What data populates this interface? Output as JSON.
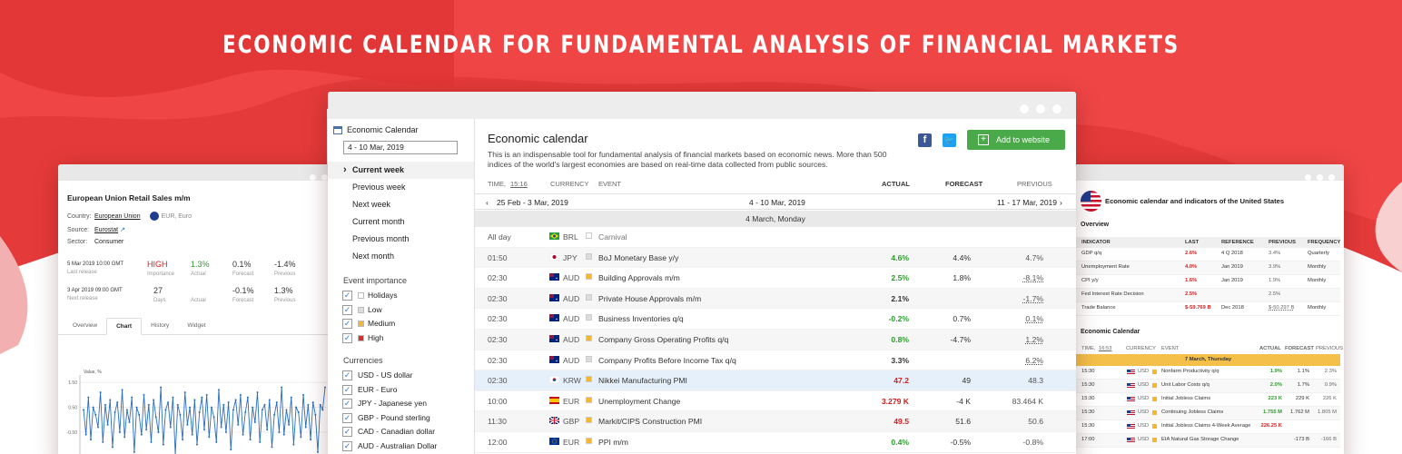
{
  "banner": "ECONOMIC CALENDAR FOR FUNDAMENTAL ANALYSIS OF FINANCIAL MARKETS",
  "colors": {
    "banner_red": "#e53a3a",
    "green": "#2a9a2a",
    "red": "#d21e1e",
    "add_button": "#4aaa4a"
  },
  "left": {
    "title": "European Union Retail Sales m/m",
    "country_label": "Country:",
    "country_value": "European Union",
    "country_extra": "EUR, Euro",
    "source_label": "Source:",
    "source_value": "Eurostat",
    "sector_label": "Sector:",
    "sector_value": "Consumer",
    "last": {
      "date": "5 Mar 2019 10:00 GMT",
      "date_sub": "Last release",
      "importance": "HIGH",
      "importance_sub": "Importance",
      "actual": "1.3%",
      "actual_sub": "Actual",
      "forecast": "0.1%",
      "forecast_sub": "Forecast",
      "previous": "-1.4%",
      "previous_sub": "Previous"
    },
    "next": {
      "date": "3 Apr 2019 09:00 GMT",
      "date_sub": "Next release",
      "days": "27",
      "days_sub": "Days",
      "actual_sub": "Actual",
      "forecast": "-0.1%",
      "forecast_sub": "Forecast",
      "previous": "1.3%",
      "previous_sub": "Previous"
    },
    "tabs": [
      "Overview",
      "Chart",
      "History",
      "Widget"
    ],
    "chart_label": "Value, %",
    "chart_ticks": [
      "1.50",
      "0.50",
      "-0.50",
      "-1.50"
    ]
  },
  "chart_data": {
    "type": "line",
    "title": "",
    "ylabel": "Value, %",
    "ylim": [
      -2.0,
      1.8
    ],
    "values": [
      0.4,
      -0.6,
      0.9,
      -0.8,
      0.5,
      0.2,
      -0.3,
      1.1,
      -0.9,
      0.6,
      -0.2,
      0.8,
      -1.1,
      0.3,
      0.7,
      -0.5,
      1.2,
      -0.7,
      0.4,
      -0.1,
      0.9,
      -1.3,
      0.5,
      0.2,
      -0.6,
      1.0,
      -0.4,
      0.6,
      -0.9,
      0.8,
      0.1,
      -0.5,
      1.3,
      -1.0,
      0.4,
      0.7,
      -0.3,
      0.9,
      -1.4,
      0.6,
      0.2,
      -0.8,
      1.1,
      -0.2,
      0.5,
      -0.6,
      0.8,
      -1.0,
      0.3,
      0.9,
      -0.4,
      1.0,
      -0.7,
      0.5,
      0.1,
      -0.9,
      1.2,
      -0.3,
      0.6,
      -0.5,
      0.7,
      -1.2,
      0.4,
      0.8,
      -0.2,
      1.0,
      -0.6,
      0.3,
      0.9,
      -0.8,
      0.5,
      -0.1,
      1.1,
      -0.9,
      0.4,
      0.6,
      -0.4,
      0.8,
      -1.1,
      0.2,
      0.7,
      -0.5,
      1.3,
      -0.6,
      0.4,
      -0.2,
      0.9,
      -1.0,
      0.5,
      0.3,
      -0.7,
      1.0,
      -0.3,
      0.6,
      -0.8,
      0.7,
      0.2,
      -1.3,
      0.6,
      0.4,
      1.3
    ]
  },
  "main": {
    "sidebar": {
      "title": "Economic Calendar",
      "date_value": "4 - 10 Mar, 2019",
      "nav": [
        "Current week",
        "Previous week",
        "Next week",
        "Current month",
        "Previous month",
        "Next month"
      ],
      "importance_title": "Event importance",
      "importance": [
        {
          "label": "Holidays",
          "color": "#ffffff"
        },
        {
          "label": "Low",
          "color": "#dcdcdc"
        },
        {
          "label": "Medium",
          "color": "#f5b731"
        },
        {
          "label": "High",
          "color": "#d9302c"
        }
      ],
      "currencies_title": "Currencies",
      "currencies": [
        "USD - US dollar",
        "EUR - Euro",
        "JPY - Japanese yen",
        "GBP - Pound sterling",
        "CAD - Canadian dollar",
        "AUD - Australian Dollar"
      ]
    },
    "title": "Economic calendar",
    "description": "This is an indispensable tool for fundamental analysis of financial markets based on economic news. More than 500 indices of the world's largest economies are based on real-time data collected from public sources.",
    "add_button": "Add to website",
    "headers": {
      "time_prefix": "TIME,",
      "time": "15:16",
      "currency": "CURRENCY",
      "event": "EVENT",
      "actual": "ACTUAL",
      "forecast": "FORECAST",
      "previous": "PREVIOUS"
    },
    "week_prev": "25 Feb - 3 Mar, 2019",
    "week_cur": "4 - 10 Mar, 2019",
    "week_next": "11 - 17 Mar, 2019",
    "day": "4 March, Monday",
    "rows": [
      {
        "time": "All day",
        "cur": "BRL",
        "flag": "br",
        "imp": "#ffffff",
        "event": "Carnival",
        "actual": "",
        "forecast": "",
        "previous": "",
        "ac": "",
        "pu": false,
        "muted": true
      },
      {
        "time": "01:50",
        "cur": "JPY",
        "flag": "jp",
        "imp": "#dcdcdc",
        "event": "BoJ Monetary Base y/y",
        "actual": "4.6%",
        "forecast": "4.4%",
        "previous": "4.7%",
        "ac": "green",
        "pu": false
      },
      {
        "time": "02:30",
        "cur": "AUD",
        "flag": "au",
        "imp": "#f5b731",
        "event": "Building Approvals m/m",
        "actual": "2.5%",
        "forecast": "1.8%",
        "previous": "-8.1%",
        "ac": "green",
        "pu": true
      },
      {
        "time": "02:30",
        "cur": "AUD",
        "flag": "au",
        "imp": "#dcdcdc",
        "event": "Private House Approvals m/m",
        "actual": "2.1%",
        "forecast": "",
        "previous": "-1.7%",
        "ac": "bold",
        "pu": true
      },
      {
        "time": "02:30",
        "cur": "AUD",
        "flag": "au",
        "imp": "#dcdcdc",
        "event": "Business Inventories q/q",
        "actual": "-0.2%",
        "forecast": "0.7%",
        "previous": "0.1%",
        "ac": "green",
        "pu": true
      },
      {
        "time": "02:30",
        "cur": "AUD",
        "flag": "au",
        "imp": "#f5b731",
        "event": "Company Gross Operating Profits q/q",
        "actual": "0.8%",
        "forecast": "-4.7%",
        "previous": "1.2%",
        "ac": "green",
        "pu": true
      },
      {
        "time": "02:30",
        "cur": "AUD",
        "flag": "au",
        "imp": "#dcdcdc",
        "event": "Company Profits Before Income Tax q/q",
        "actual": "3.3%",
        "forecast": "",
        "previous": "6.2%",
        "ac": "bold",
        "pu": true
      },
      {
        "time": "02:30",
        "cur": "KRW",
        "flag": "kr",
        "imp": "#f5b731",
        "event": "Nikkei Manufacturing PMI",
        "actual": "47.2",
        "forecast": "49",
        "previous": "48.3",
        "ac": "red",
        "pu": false,
        "hl": true
      },
      {
        "time": "10:00",
        "cur": "EUR",
        "flag": "es",
        "imp": "#f5b731",
        "event": "Unemployment Change",
        "actual": "3.279 K",
        "forecast": "-4 K",
        "previous": "83.464 K",
        "ac": "red",
        "pu": false
      },
      {
        "time": "11:30",
        "cur": "GBP",
        "flag": "gb",
        "imp": "#f5b731",
        "event": "Markit/CIPS Construction PMI",
        "actual": "49.5",
        "forecast": "51.6",
        "previous": "50.6",
        "ac": "red",
        "pu": false
      },
      {
        "time": "12:00",
        "cur": "EUR",
        "flag": "eu",
        "imp": "#f5b731",
        "event": "PPI m/m",
        "actual": "0.4%",
        "forecast": "-0.5%",
        "previous": "-0.8%",
        "ac": "green",
        "pu": false
      }
    ]
  },
  "right": {
    "title": "Economic calendar and indicators of the United States",
    "overview": "Overview",
    "ov_headers": [
      "INDICATOR",
      "LAST",
      "REFERENCE",
      "PREVIOUS",
      "FREQUENCY"
    ],
    "ov_rows": [
      [
        "GDP q/q",
        "2.6%",
        "4 Q 2018",
        "3.4%",
        "Quarterly"
      ],
      [
        "Unemployment Rate",
        "4.0%",
        "Jan 2019",
        "3.9%",
        "Monthly"
      ],
      [
        "CPI y/y",
        "1.6%",
        "Jan 2019",
        "1.9%",
        "Monthly"
      ],
      [
        "Fed Interest Rate Decision",
        "2.5%",
        "",
        "2.5%",
        ""
      ],
      [
        "Trade Balance",
        "$-59.769 B",
        "Dec 2018",
        "$-50.297 B",
        "Monthly"
      ]
    ],
    "cal_title": "Economic Calendar",
    "cal_headers": [
      "TIME,",
      "16:53",
      "CURRENCY",
      "EVENT",
      "ACTUAL",
      "FORECAST",
      "PREVIOUS"
    ],
    "cal_day": "7 March, Thursday",
    "cal_rows": [
      [
        "15:30",
        "USD",
        "Nonfarm Productivity q/q",
        "1.9%",
        "1.1%",
        "2.3%",
        "green"
      ],
      [
        "15:30",
        "USD",
        "Unit Labor Costs q/q",
        "2.0%",
        "1.7%",
        "0.9%",
        "green"
      ],
      [
        "15:30",
        "USD",
        "Initial Jobless Claims",
        "223 K",
        "229 K",
        "226 K",
        "green"
      ],
      [
        "15:30",
        "USD",
        "Continuing Jobless Claims",
        "1.755 M",
        "1.762 M",
        "1.805 M",
        "green"
      ],
      [
        "15:30",
        "USD",
        "Initial Jobless Claims 4-Week Average",
        "226.25 K",
        "",
        "",
        "red"
      ],
      [
        "17:00",
        "USD",
        "EIA Natural Gas Storage Change",
        "",
        "-173 B",
        "-166 B",
        ""
      ]
    ]
  }
}
